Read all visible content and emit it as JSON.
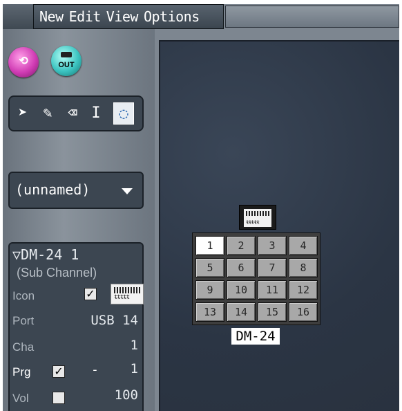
{
  "menu": {
    "items": [
      "New",
      "Edit",
      "View",
      "Options"
    ]
  },
  "buttons": {
    "out_label": "OUT"
  },
  "dropdown": {
    "value": "(unnamed)"
  },
  "properties": {
    "device_title": "▽DM-24 1",
    "subtitle": "(Sub Channel)",
    "icon_label": "Icon",
    "icon_checked": "✓",
    "port_label": "Port",
    "port_value": "USB 14",
    "cha_label": "Cha",
    "cha_value": "1",
    "prg_label": "Prg",
    "prg_checked": "✓",
    "prg_dash": "-",
    "prg_value": "1",
    "vol_label": "Vol",
    "vol_value": "100"
  },
  "workspace": {
    "device_label": "DM-24",
    "selected_channel": "1",
    "channels": [
      "1",
      "2",
      "3",
      "4",
      "5",
      "6",
      "7",
      "8",
      "9",
      "10",
      "11",
      "12",
      "13",
      "14",
      "15",
      "16"
    ]
  },
  "colors": {
    "workspace_bg": "#2f3a4a",
    "panel_bg": "#3c4651",
    "menubar": "#4a5560"
  }
}
